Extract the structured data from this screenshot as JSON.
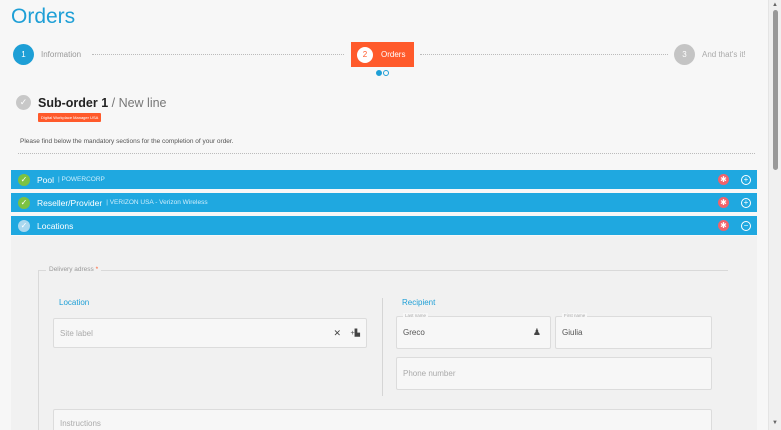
{
  "page": {
    "title": "Orders"
  },
  "stepper": {
    "steps": [
      {
        "number": "1",
        "label": "Information"
      },
      {
        "number": "2",
        "label": "Orders"
      },
      {
        "number": "3",
        "label": "And that's it!"
      }
    ]
  },
  "suborder": {
    "title": "Sub-order 1",
    "subtitle": " / New line",
    "badge": "Digital Workplace Manager USA",
    "description": "Please find below the mandatory sections for the completion of your order."
  },
  "sections": [
    {
      "name": "Pool",
      "value": "| POWERCORP"
    },
    {
      "name": "Reseller/Provider",
      "value": "| VERIZON USA - Verizon Wireless"
    },
    {
      "name": "Locations",
      "value": ""
    }
  ],
  "locations": {
    "legend": "Delivery adress",
    "required_mark": "*",
    "location_title": "Location",
    "site_label_placeholder": "Site label",
    "recipient_title": "Recipient",
    "last_name_label": "Last name",
    "last_name_value": "Greco",
    "first_name_label": "First name",
    "first_name_value": "Giulia",
    "phone_placeholder": "Phone number",
    "instructions_placeholder": "Instructions"
  },
  "icons": {
    "check": "✓",
    "star": "✱",
    "plus_circle": "+",
    "minus_circle": "−",
    "clear": "✕",
    "add_site": "+▙",
    "person_search": "♟"
  },
  "colors": {
    "accent": "#1e9fd6",
    "bar": "#1fa8e0",
    "active_step": "#ff5a2b",
    "done": "#7cc242",
    "required": "#f0636b"
  }
}
